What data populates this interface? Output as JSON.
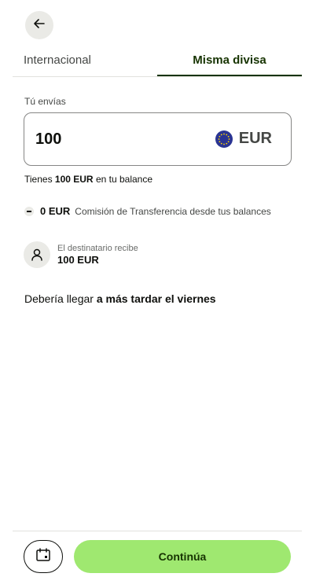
{
  "header": {
    "back_icon": "arrow-left-icon"
  },
  "tabs": [
    {
      "label": "Internacional",
      "active": false
    },
    {
      "label": "Misma divisa",
      "active": true
    }
  ],
  "send": {
    "label": "Tú envías",
    "amount": "100",
    "currency": "EUR",
    "currency_icon": "eu-flag-icon"
  },
  "balance": {
    "prefix": "Tienes ",
    "amount": "100 EUR",
    "suffix": " en tu balance"
  },
  "fee": {
    "icon": "minus-icon",
    "amount": "0 EUR",
    "description": "Comisión de Transferencia desde tus balances"
  },
  "recipient": {
    "icon": "person-icon",
    "label": "El destinatario recibe",
    "amount": "100 EUR"
  },
  "arrival": {
    "prefix": "Debería llegar ",
    "emphasis": "a más tardar el viernes"
  },
  "footer": {
    "calendar_icon": "calendar-icon",
    "continue_label": "Continúa"
  },
  "colors": {
    "accent": "#9fe870",
    "dark_green": "#163300",
    "eu_blue": "#2a3493"
  }
}
